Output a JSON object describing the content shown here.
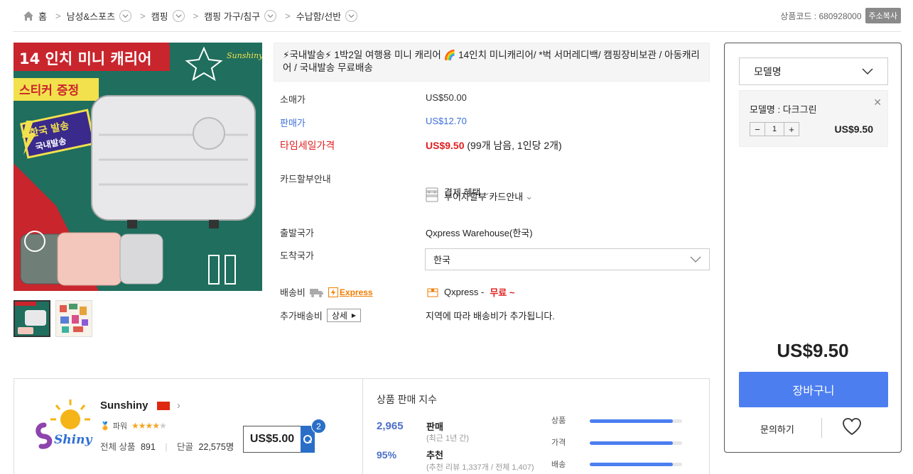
{
  "breadcrumb": {
    "items": [
      "홈",
      "남성&스포츠",
      "캠핑",
      "캠핑 가구/침구",
      "수납함/선반"
    ],
    "product_code_label": "상품코드 : 680928000",
    "copy_label": "주소복사"
  },
  "gallery": {
    "banner_title": "14 인치 미니 캐리어",
    "sticker_text": "스티커 증정",
    "domestic_text": "한국 발송",
    "domestic_sub": "국내발송",
    "brand_mark": "Sunshiny"
  },
  "product": {
    "title": "⚡국내발송⚡ 1박2일 여행용 미니 캐리어 🌈 14인치 미니캐리어/ *벅 서머레디백/ 캠핑장비보관 / 아동캐리어 / 국내발송 무료배송",
    "retail_label": "소매가",
    "retail_price": "US$50.00",
    "sale_label": "판매가",
    "sale_price": "US$12.70",
    "timesale_label": "타임세일가격",
    "timesale_price": "US$9.50",
    "timesale_note": "(99개 남음, 1인당 2개)",
    "card_label": "카드할부안내",
    "card_benefit": "결제 혜택",
    "card_installment": "무이자할부 카드안내",
    "origin_label": "출발국가",
    "origin_value": "Qxpress Warehouse(한국)",
    "dest_label": "도착국가",
    "dest_value": "한국",
    "shipping_label": "배송비",
    "express_label": "Express",
    "shipping_carrier": "Qxpress -",
    "shipping_free": "무료 ~",
    "extra_label": "추가배송비",
    "detail_btn": "상세",
    "extra_note": "지역에 따라 배송비가 추가됩니다."
  },
  "side": {
    "model_select": "모델명",
    "selected_model": "모델명 : 다크그린",
    "qty": "1",
    "item_price": "US$9.50",
    "total": "US$9.50",
    "cart_label": "장바구니",
    "ask_label": "문의하기"
  },
  "seller": {
    "name": "Sunshiny",
    "power_label": "파워",
    "rating_stars": 4.5,
    "total_products_label": "전체 상품",
    "total_products": "891",
    "regulars_label": "단골",
    "regulars": "22,575명",
    "coupon_value": "US$5.00",
    "coupon_count": "2"
  },
  "sales_index": {
    "title": "상품 판매 지수",
    "sold_number": "2,965",
    "sold_label": "판매",
    "sold_sub": "(최근 1년 간)",
    "recommend_number": "95%",
    "recommend_label": "추천",
    "recommend_sub": "(추천 리뷰 1,337개 / 전체 1,407)",
    "bars": [
      {
        "label": "상품",
        "value": 0.9
      },
      {
        "label": "가격",
        "value": 0.9
      },
      {
        "label": "배송",
        "value": 0.9
      }
    ]
  },
  "colors": {
    "accent_blue": "#4c7ef0",
    "price_red": "#e02020",
    "sale_blue": "#3b6fd8"
  }
}
